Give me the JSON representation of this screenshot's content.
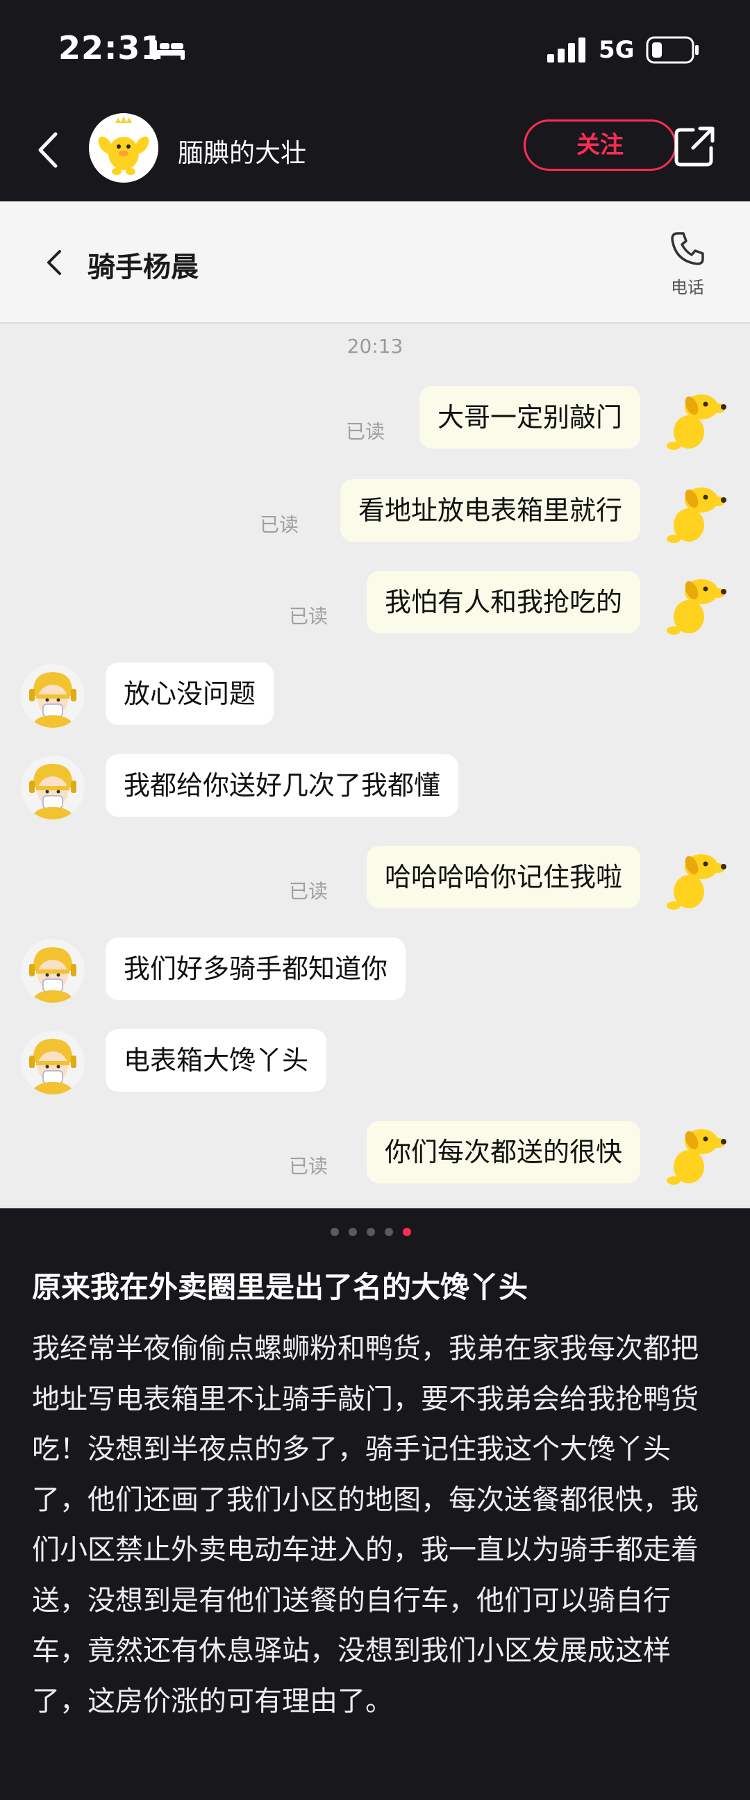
{
  "status_bar": {
    "time": "22:31",
    "network": "5G"
  },
  "header": {
    "author_name": "腼腆的大壮",
    "follow_label": "关注"
  },
  "chat": {
    "title": "骑手杨晨",
    "phone_label": "电话",
    "timestamp": "20:13",
    "read_label": "已读",
    "messages": [
      {
        "from": "me",
        "text": "大哥一定别敲门",
        "read": "已读"
      },
      {
        "from": "me",
        "text": "看地址放电表箱里就行",
        "read": "已读"
      },
      {
        "from": "me",
        "text": "我怕有人和我抢吃的",
        "read": "已读"
      },
      {
        "from": "rider",
        "text": "放心没问题"
      },
      {
        "from": "rider",
        "text": "我都给你送好几次了我都懂"
      },
      {
        "from": "me",
        "text": "哈哈哈哈你记住我啦",
        "read": "已读"
      },
      {
        "from": "rider",
        "text": "我们好多骑手都知道你"
      },
      {
        "from": "rider",
        "text": "电表箱大馋丫头"
      },
      {
        "from": "me",
        "text": "你们每次都送的很快",
        "read": "已读"
      }
    ]
  },
  "pagination": {
    "count": 5,
    "active_index": 4,
    "active_color": "#fe2c55"
  },
  "post": {
    "title": "原来我在外卖圈里是出了名的大馋丫头",
    "body": "我经常半夜偷偷点螺蛳粉和鸭货，我弟在家我每次都把地址写电表箱里不让骑手敲门，要不我弟会给我抢鸭货吃！没想到半夜点的多了，骑手记住我这个大馋丫头了，他们还画了我们小区的地图，每次送餐都很快，我们小区禁止外卖电动车进入的，我一直以为骑手都走着送，没想到是有他们送餐的自行车，他们可以骑自行车，竟然还有休息驿站，没想到我们小区发展成这样了，这房价涨的可有理由了。"
  },
  "colors": {
    "accent": "#fe2c55",
    "background": "#17171c",
    "bubble_out": "#fbfbe9",
    "bubble_in": "#ffffff"
  }
}
